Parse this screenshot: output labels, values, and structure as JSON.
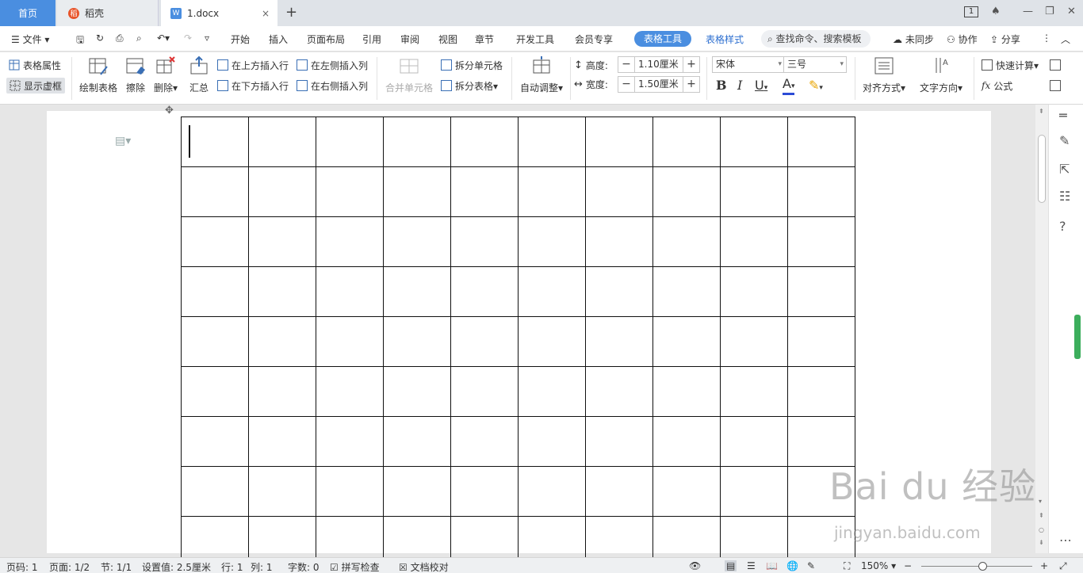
{
  "tabs": {
    "home": "首页",
    "daoke": "稻壳",
    "doc": "1.docx",
    "close": "×",
    "add": "+"
  },
  "window": {
    "badge": "1",
    "minimize": "—",
    "restore": "❐",
    "close": "✕"
  },
  "menu": {
    "file": "文件",
    "items": [
      "开始",
      "插入",
      "页面布局",
      "引用",
      "审阅",
      "视图",
      "章节",
      "开发工具",
      "会员专享"
    ],
    "active": "表格工具",
    "table_style": "表格样式",
    "search": "查找命令、搜索模板",
    "sync": "未同步",
    "collab": "协作",
    "share": "分享"
  },
  "ribbon": {
    "table_props": "表格属性",
    "show_gridlines": "显示虚框",
    "draw_table": "绘制表格",
    "erase": "擦除",
    "delete": "删除",
    "summary": "汇总",
    "insert_row_above": "在上方插入行",
    "insert_row_below": "在下方插入行",
    "insert_col_left": "在左侧插入列",
    "insert_col_right": "在右侧插入列",
    "merge_cells": "合并单元格",
    "split_cells": "拆分单元格",
    "split_table": "拆分表格",
    "autofit": "自动调整",
    "height_label": "高度:",
    "height_value": "1.10厘米",
    "width_label": "宽度:",
    "width_value": "1.50厘米",
    "font_name": "宋体",
    "font_size": "三号",
    "align": "对齐方式",
    "text_direction": "文字方向",
    "quick_calc": "快速计算",
    "formula": "公式",
    "minus": "−",
    "plus": "+"
  },
  "table": {
    "rows": 9,
    "cols": 10
  },
  "statusbar": {
    "page_num": "页码: 1",
    "pages": "页面: 1/2",
    "section": "节: 1/1",
    "setting": "设置值: 2.5厘米",
    "row": "行: 1",
    "col": "列: 1",
    "words": "字数: 0",
    "spellcheck": "拼写检查",
    "proofread": "文档校对",
    "zoom": "150%"
  },
  "watermark": {
    "main": "Bai du 经验",
    "sub": "jingyan.baidu.com"
  },
  "colors": {
    "accent": "#4a8ee0",
    "green": "#3cae5c"
  }
}
